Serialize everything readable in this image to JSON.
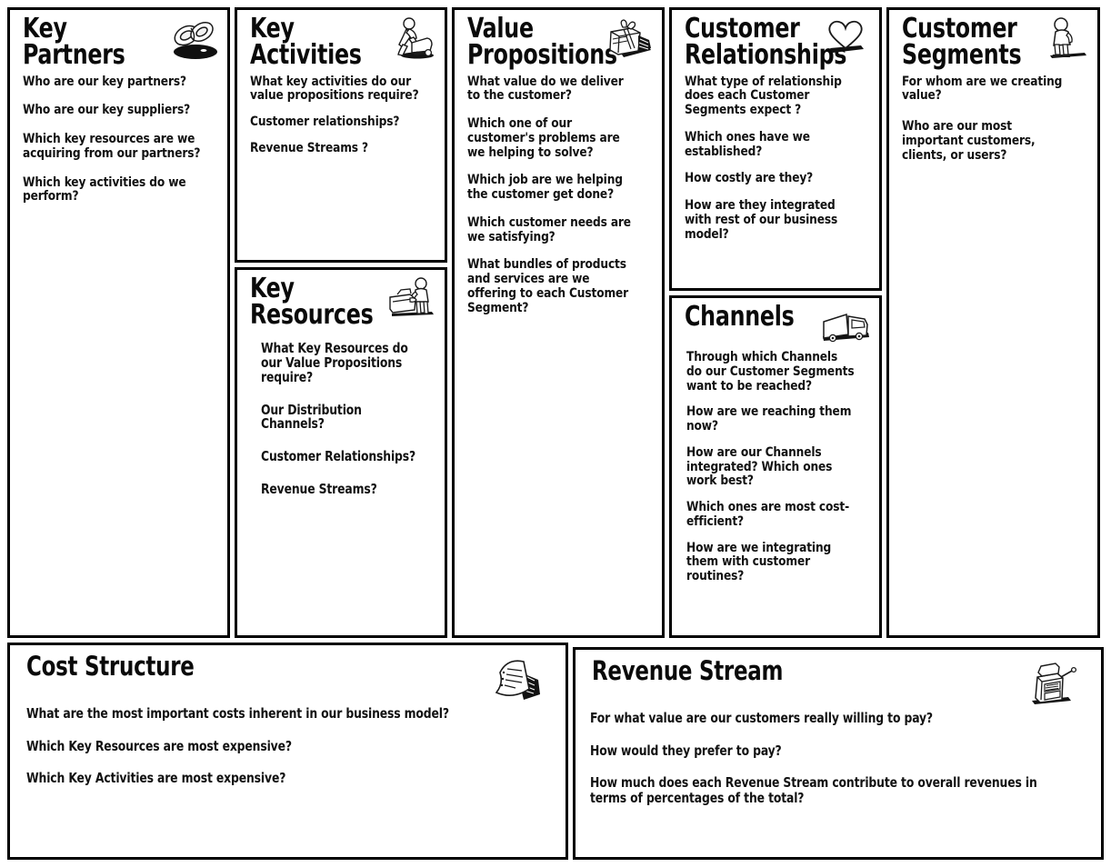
{
  "canvas": {
    "blocks": {
      "key_partners": {
        "title": "Key\nPartners",
        "icon": "linked-rings-icon",
        "questions": [
          "Who are our key partners?",
          "Who are our key suppliers?",
          "Which key resources are we acquiring from our partners?",
          "Which key activities do we perform?"
        ]
      },
      "key_activities": {
        "title": "Key\nActivities",
        "icon": "worker-machine-icon",
        "questions": [
          "What key activities do our value propositions require?",
          "Customer relationships?",
          "Revenue Streams ?"
        ]
      },
      "key_resources": {
        "title": "Key\nResources",
        "icon": "person-equipment-icon",
        "questions": [
          "What Key Resources do our Value Propositions require?",
          "Our Distribution Channels?",
          "Customer Relationships?",
          "Revenue Streams?"
        ]
      },
      "value_propositions": {
        "title": "Value\nPropositions",
        "icon": "gift-box-icon",
        "questions": [
          "What value do we deliver to the customer?",
          "Which one of our customer's problems are we helping to solve?",
          "Which job are we helping the customer get done?",
          "Which customer needs are we satisfying?",
          "What bundles of products and services are we offering to each Customer Segment?"
        ]
      },
      "customer_relationships": {
        "title": "Customer\nRelationships",
        "icon": "heart-icon",
        "questions": [
          "What type of relationship does each Customer Segments expect ?",
          "Which ones have we established?",
          "How costly are they?",
          "How are they integrated with rest of our business model?"
        ]
      },
      "channels": {
        "title": "Channels",
        "icon": "delivery-truck-icon",
        "questions": [
          "Through which Channels do our Customer Segments want to be reached?",
          "How are we reaching them now?",
          "How are our Channels integrated? Which ones work best?",
          "Which ones are most cost-efficient?",
          "How are we integrating them with customer routines?"
        ]
      },
      "customer_segments": {
        "title": "Customer\nSegments",
        "icon": "standing-person-icon",
        "questions": [
          "For whom are we creating value?",
          "Who are our most important customers, clients, or users?"
        ]
      },
      "cost_structure": {
        "title": "Cost Structure",
        "icon": "invoice-paper-icon",
        "questions": [
          "What are the most important costs inherent in our business model?",
          "Which Key Resources are most expensive?",
          "Which Key Activities are most expensive?"
        ]
      },
      "revenue_stream": {
        "title": "Revenue Stream",
        "icon": "cash-register-icon",
        "questions": [
          "For what value are our customers really willing to pay?",
          "How would they prefer to pay?",
          "How much does each Revenue Stream contribute to overall revenues in terms of percentages of the total?"
        ]
      }
    },
    "colors": {
      "border": "#000000",
      "background": "#ffffff",
      "text": "#111111"
    }
  }
}
